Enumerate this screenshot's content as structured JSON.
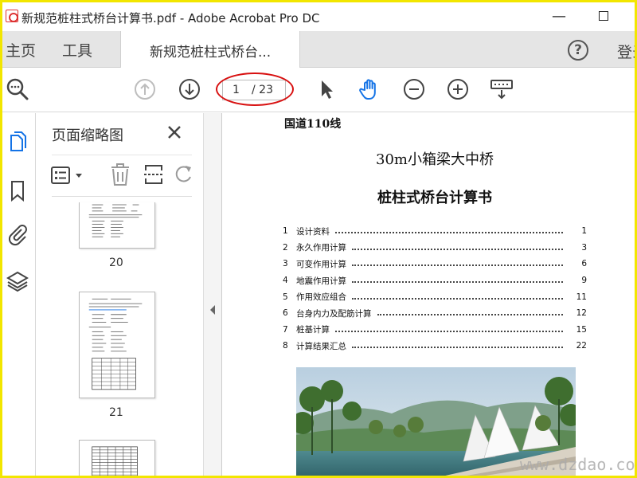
{
  "window": {
    "title": "新规范桩柱式桥台计算书.pdf - Adobe Acrobat Pro DC",
    "minimize": "—"
  },
  "tabs": {
    "home": "主页",
    "tools": "工具",
    "document": "新规范桩柱式桥台...",
    "help": "?",
    "signin": "登录"
  },
  "toolbar": {
    "page_current": "1",
    "page_total": "/ 23"
  },
  "thumbnails": {
    "title": "页面缩略图",
    "pages": [
      "20",
      "21"
    ]
  },
  "document": {
    "road": "国道110线",
    "subtitle": "30m小箱梁大中桥",
    "title": "桩柱式桥台计算书",
    "toc": [
      {
        "num": "1",
        "label": "设计资料",
        "page": "1"
      },
      {
        "num": "2",
        "label": "永久作用计算",
        "page": "3"
      },
      {
        "num": "3",
        "label": "可变作用计算",
        "page": "6"
      },
      {
        "num": "4",
        "label": "地震作用计算",
        "page": "9"
      },
      {
        "num": "5",
        "label": "作用效应组合",
        "page": "11"
      },
      {
        "num": "6",
        "label": "台身内力及配筋计算",
        "page": "12"
      },
      {
        "num": "7",
        "label": "桩基计算",
        "page": "15"
      },
      {
        "num": "8",
        "label": "计算结果汇总",
        "page": "22"
      }
    ]
  },
  "watermark": "www.dzdao.com",
  "colors": {
    "accent": "#1473e6",
    "highlight": "#d81010",
    "frame": "#f2e600"
  }
}
